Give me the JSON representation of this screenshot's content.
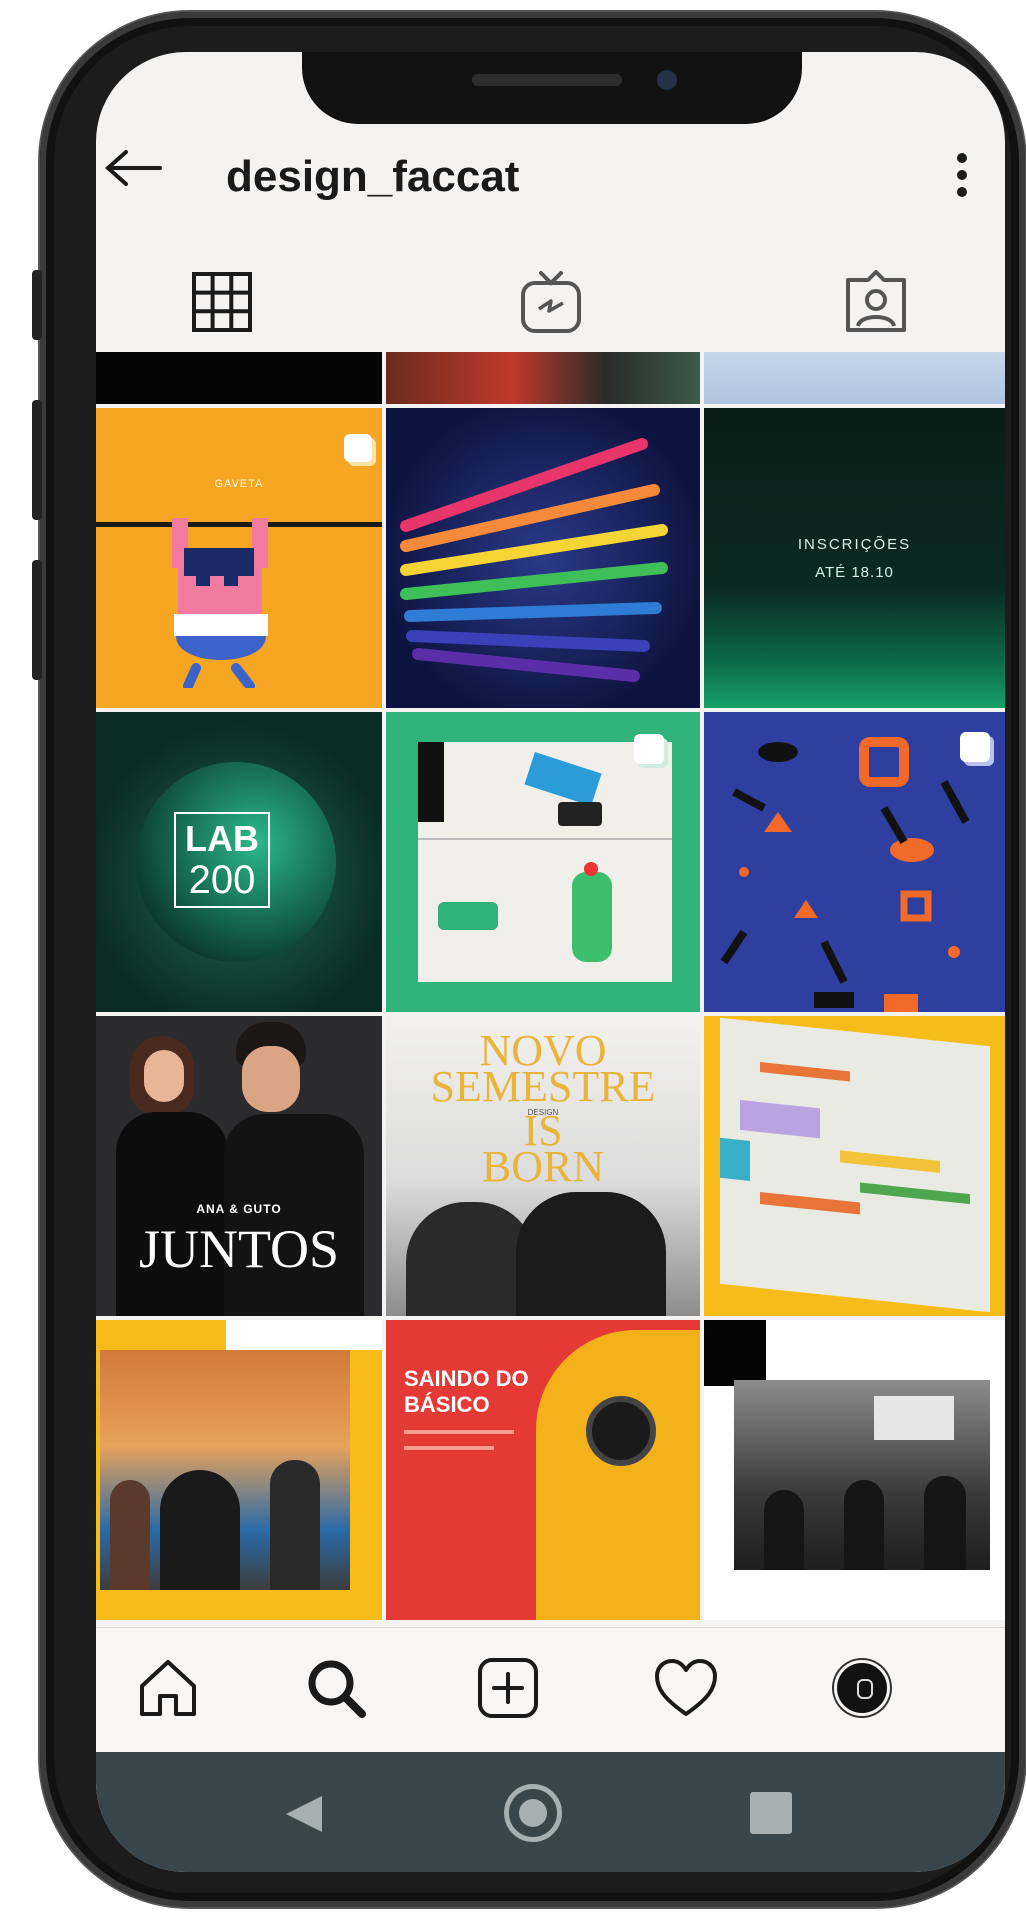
{
  "header": {
    "username": "design_faccat",
    "back_icon": "arrow-left-icon",
    "more_icon": "more-vertical-icon"
  },
  "tabs": [
    {
      "icon": "grid-icon",
      "selected": true
    },
    {
      "icon": "igtv-icon",
      "selected": false
    },
    {
      "icon": "tagged-icon",
      "selected": false
    }
  ],
  "posts": {
    "p1_gaveta": "GAVETA",
    "p3_line1": "INSCRIÇÕES",
    "p3_line2": "ATÉ 18.10",
    "p4_lab": "LAB",
    "p4_num": "200",
    "p7_small": "ANA & GUTO",
    "p7_big": "JUNTOS",
    "p8_l1": "NOVO",
    "p8_l2": "SEMESTRE",
    "p8_l3": "IS",
    "p8_l4": "BORN",
    "p8_small": "DESIGN",
    "p11_l1": "SAINDO DO",
    "p11_l2": "BÁSICO"
  },
  "bottom_nav": [
    {
      "name": "home",
      "icon": "home-icon"
    },
    {
      "name": "search",
      "icon": "search-icon"
    },
    {
      "name": "new-post",
      "icon": "plus-square-icon"
    },
    {
      "name": "activity",
      "icon": "heart-icon"
    },
    {
      "name": "profile",
      "icon": "avatar-icon"
    }
  ],
  "system_nav": [
    "back-triangle-icon",
    "home-circle-icon",
    "recents-square-icon"
  ],
  "colors": {
    "background": "#f4f3f1",
    "accent_orange": "#f6a623",
    "green": "#2fb37a",
    "android_bar": "#38454a"
  }
}
